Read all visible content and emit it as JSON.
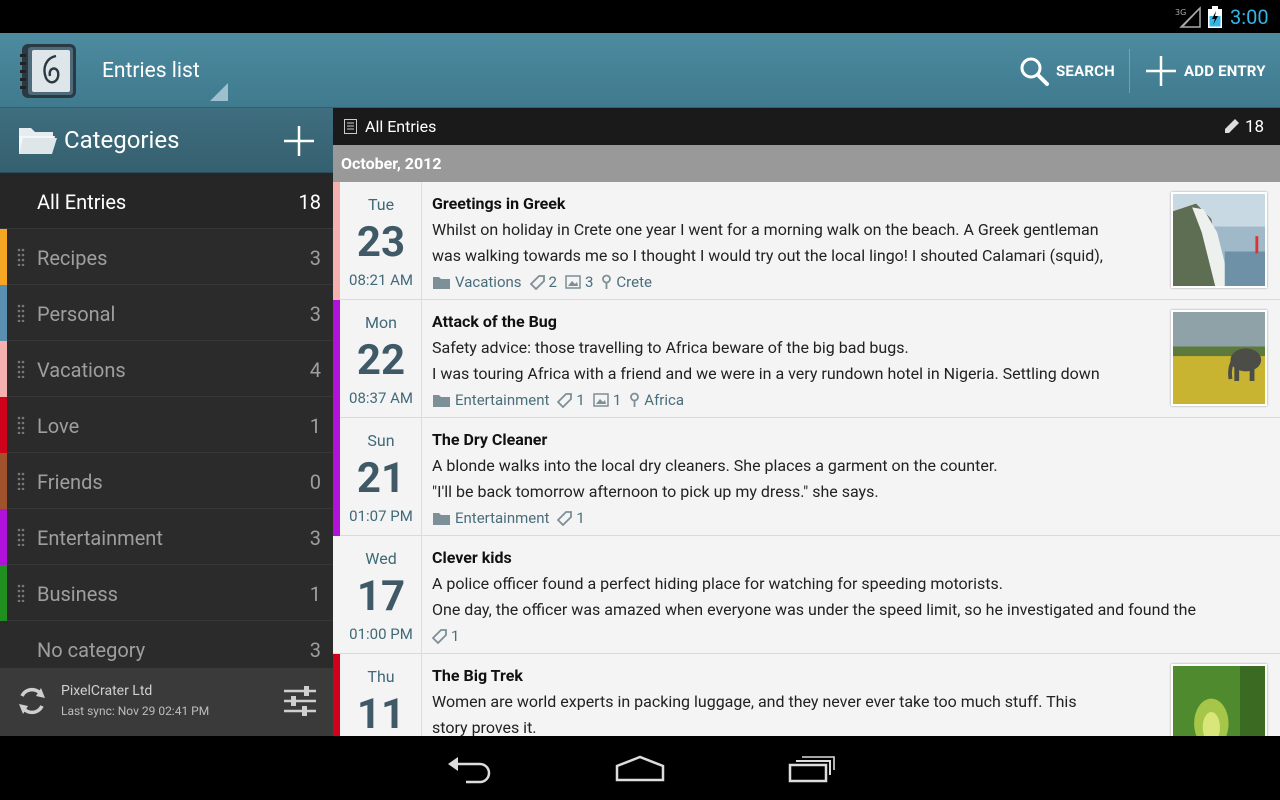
{
  "status": {
    "network": "3G",
    "time": "3:00"
  },
  "actionbar": {
    "title": "Entries list",
    "search_label": "SEARCH",
    "add_label": "ADD ENTRY"
  },
  "sidebar": {
    "header": "Categories",
    "items": [
      {
        "label": "All Entries",
        "count": "18",
        "color": ""
      },
      {
        "label": "Recipes",
        "count": "3",
        "color": "#f5a623"
      },
      {
        "label": "Personal",
        "count": "3",
        "color": "#5b8fb0"
      },
      {
        "label": "Vacations",
        "count": "4",
        "color": "#f7b0b0"
      },
      {
        "label": "Love",
        "count": "1",
        "color": "#d0021b"
      },
      {
        "label": "Friends",
        "count": "0",
        "color": "#a0522d"
      },
      {
        "label": "Entertainment",
        "count": "3",
        "color": "#b012d9"
      },
      {
        "label": "Business",
        "count": "1",
        "color": "#1f8f1f"
      },
      {
        "label": "No category",
        "count": "3",
        "color": ""
      }
    ],
    "sync": {
      "account": "PixelCrater Ltd",
      "last_sync": "Last sync: Nov 29 02:41 PM"
    }
  },
  "main": {
    "header_title": "All Entries",
    "header_count": "18",
    "month": "October, 2012",
    "entries": [
      {
        "dow": "Tue",
        "day": "23",
        "time": "08:21 AM",
        "color": "#f7b0b0",
        "title": "Greetings in Greek",
        "line1": "Whilst on holiday in Crete one year I went for a morning walk on the beach. A Greek gentleman",
        "line2": "was walking towards me so I thought I would try out the local lingo! I shouted Calamari (squid),",
        "category": "Vacations",
        "tags": "2",
        "photos": "3",
        "location": "Crete",
        "thumb": "cliffs"
      },
      {
        "dow": "Mon",
        "day": "22",
        "time": "08:37 AM",
        "color": "#b012d9",
        "title": "Attack of the Bug",
        "line1": "Safety advice: those travelling to Africa beware of the big bad bugs.",
        "line2": "I was touring Africa with a friend and we were in a very rundown hotel in Nigeria. Settling down",
        "category": "Entertainment",
        "tags": "1",
        "photos": "1",
        "location": "Africa",
        "thumb": "elephant"
      },
      {
        "dow": "Sun",
        "day": "21",
        "time": "01:07 PM",
        "color": "#b012d9",
        "title": "The Dry Cleaner",
        "line1": "A blonde walks into the local dry cleaners. She places a garment on the counter.",
        "line2": "\"I'll be back tomorrow afternoon to pick up my dress.\" she says.",
        "category": "Entertainment",
        "tags": "1",
        "photos": "",
        "location": "",
        "thumb": ""
      },
      {
        "dow": "Wed",
        "day": "17",
        "time": "01:00 PM",
        "color": "",
        "title": "Clever kids",
        "line1": "A police officer found a perfect hiding place for watching for speeding motorists.",
        "line2": "One day, the officer was amazed when everyone was under the speed limit, so he investigated and found the",
        "category": "",
        "tags": "1",
        "photos": "",
        "location": "",
        "thumb": ""
      },
      {
        "dow": "Thu",
        "day": "11",
        "time": "",
        "color": "#d0021b",
        "title": "The Big Trek",
        "line1": "Women are world experts in packing luggage, and they never ever take too much stuff. This",
        "line2": "story proves it.",
        "category": "",
        "tags": "",
        "photos": "",
        "location": "",
        "thumb": "forest"
      }
    ]
  }
}
